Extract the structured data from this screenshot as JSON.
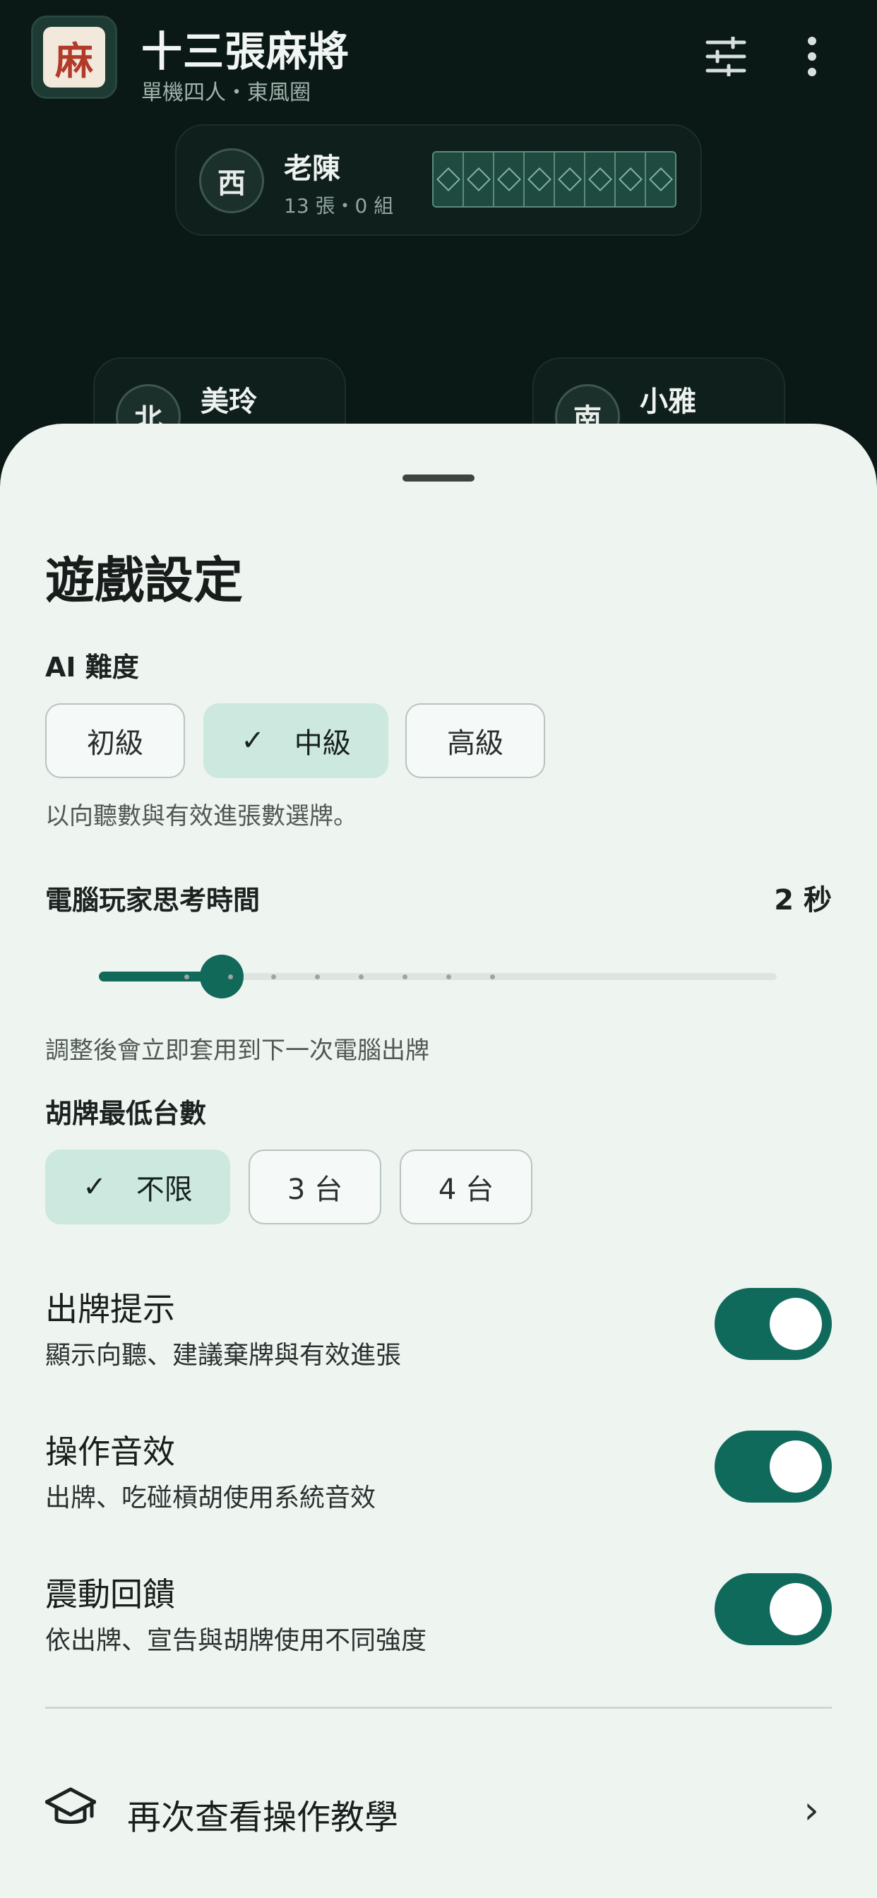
{
  "app": {
    "title": "十三張麻將",
    "subtitle": "單機四人・東風圈",
    "icon_glyph": "麻"
  },
  "opponents": {
    "top": {
      "seat": "西",
      "name": "老陳",
      "meta": "13 張・0 組"
    },
    "left": {
      "seat": "北",
      "name": "美玲"
    },
    "right": {
      "seat": "南",
      "name": "小雅"
    }
  },
  "settings": {
    "title": "遊戲設定",
    "ai": {
      "label": "AI 難度",
      "options": [
        "初級",
        "中級",
        "高級"
      ],
      "selected": "中級",
      "helper": "以向聽數與有效進張數選牌。"
    },
    "think_time": {
      "label": "電腦玩家思考時間",
      "value_text": "2 秒",
      "level": 2,
      "min": 1,
      "max": 10,
      "helper": "調整後會立即套用到下一次電腦出牌"
    },
    "min_tai": {
      "label": "胡牌最低台數",
      "options": [
        "不限",
        "3 台",
        "4 台"
      ],
      "selected": "不限"
    },
    "toggles": [
      {
        "title": "出牌提示",
        "subtitle": "顯示向聽、建議棄牌與有效進張",
        "on": true
      },
      {
        "title": "操作音效",
        "subtitle": "出牌、吃碰槓胡使用系統音效",
        "on": true
      },
      {
        "title": "震動回饋",
        "subtitle": "依出牌、宣告與胡牌使用不同強度",
        "on": true
      }
    ],
    "tutorial_label": "再次查看操作教學"
  },
  "colors": {
    "accent": "#11695a",
    "chip_selected": "#cce8df",
    "sheet_bg": "#eef4f0",
    "table_bg": "#0b1916"
  },
  "icons": {
    "tune": "tune-icon",
    "more": "more-vert-icon",
    "check": "check-icon",
    "school": "school-icon",
    "chevron": "chevron-right-icon"
  }
}
